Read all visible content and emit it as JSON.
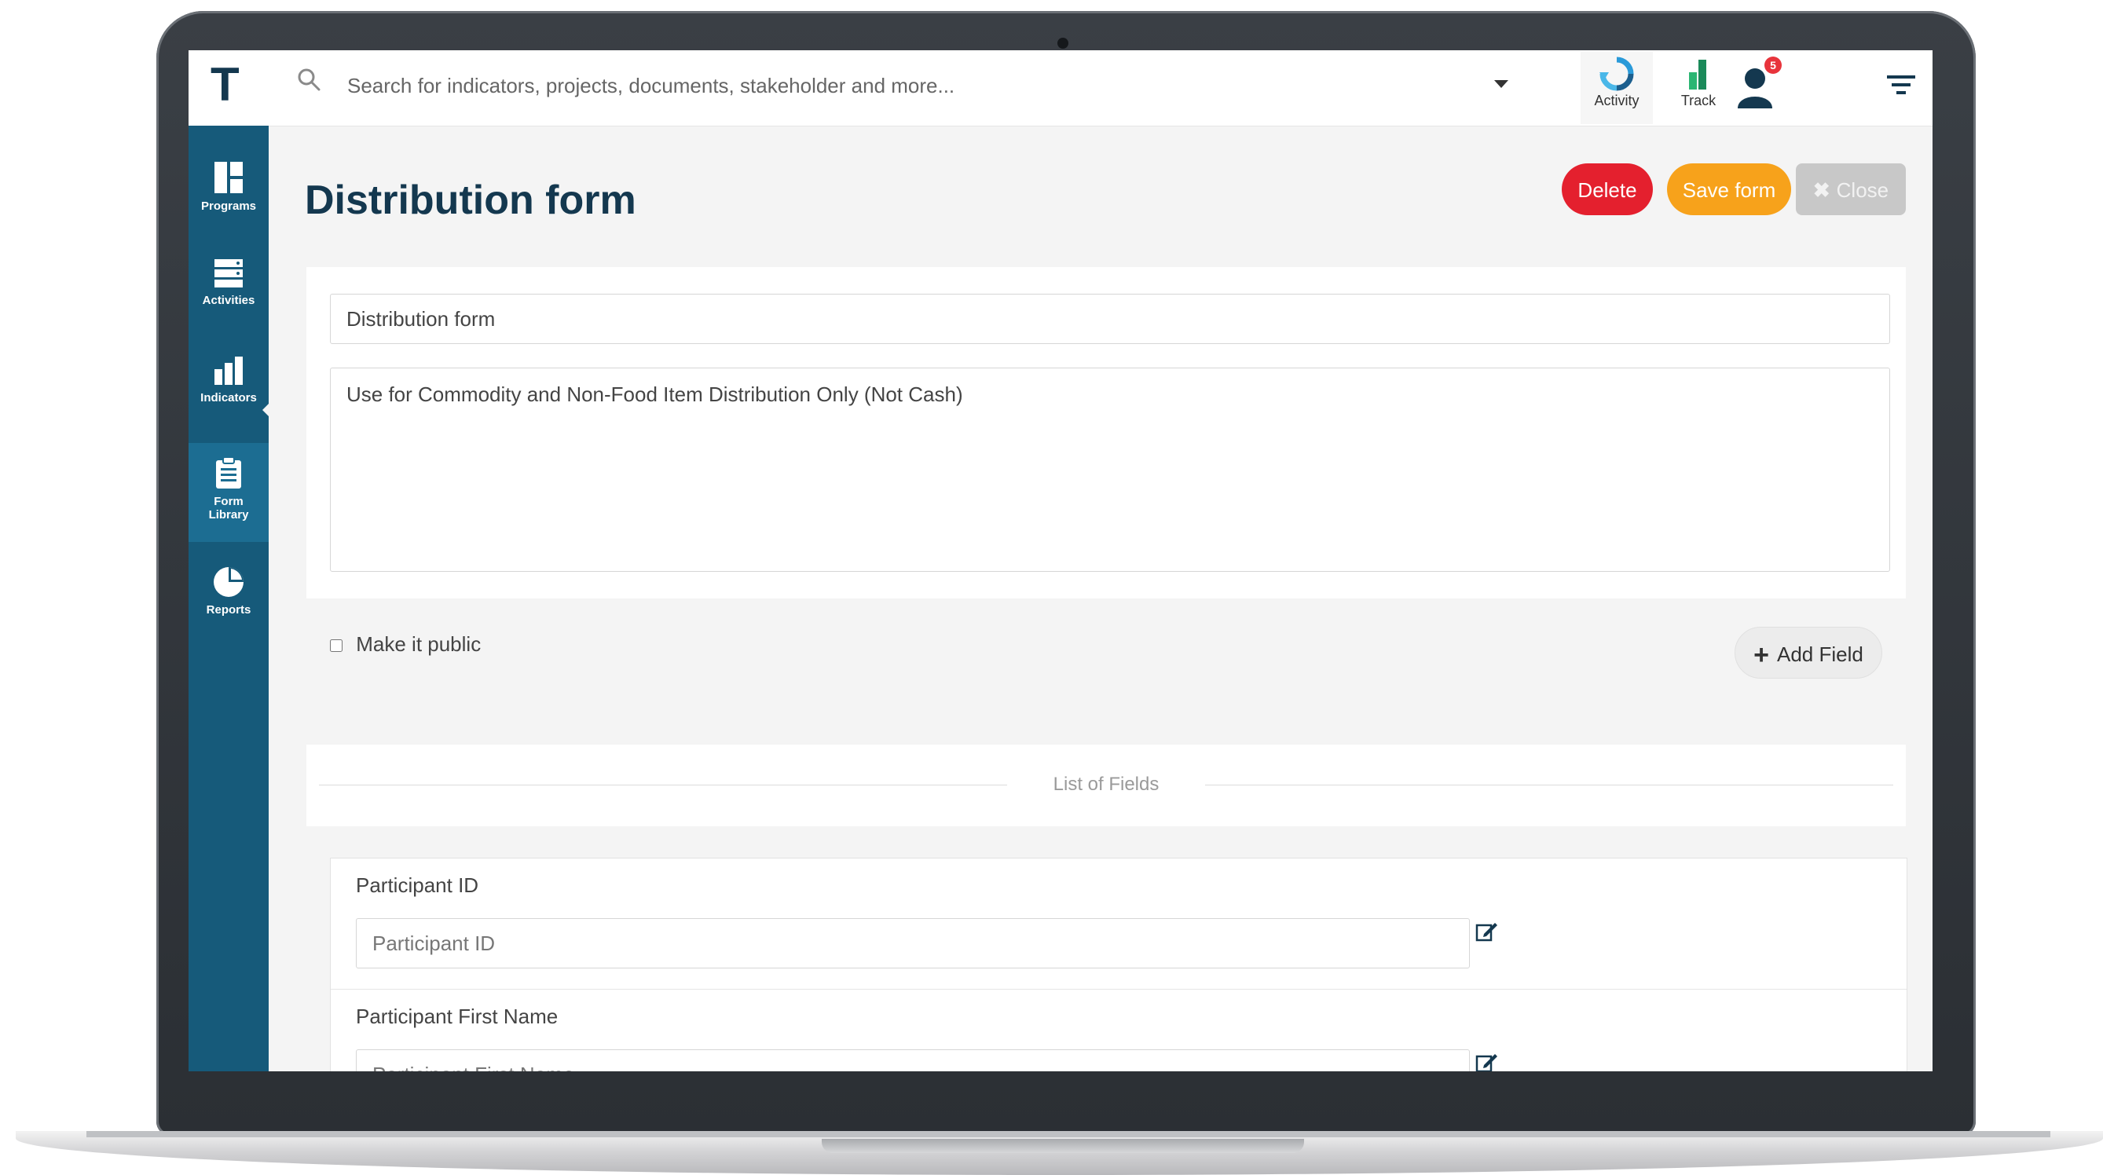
{
  "app": {
    "logo_letter": "T",
    "search_placeholder": "Search for indicators, projects, documents, stakeholder and more...",
    "tools": {
      "activity_label": "Activity",
      "track_label": "Track"
    },
    "notifications_count": "5"
  },
  "sidebar": {
    "items": [
      {
        "label": "Programs",
        "icon": "programs-icon"
      },
      {
        "label": "Activities",
        "icon": "activities-icon"
      },
      {
        "label": "Indicators",
        "icon": "indicators-icon"
      },
      {
        "label_line1": "Form",
        "label_line2": "Library",
        "icon": "clipboard-icon",
        "active": true
      },
      {
        "label": "Reports",
        "icon": "pie-chart-icon"
      }
    ]
  },
  "page": {
    "title": "Distribution form",
    "buttons": {
      "delete": "Delete",
      "save": "Save form",
      "close": "Close"
    }
  },
  "form": {
    "name_value": "Distribution form",
    "description_value": "Use for Commodity and Non-Food Item Distribution Only (Not Cash)",
    "make_public_label": "Make it public",
    "make_public_checked": false,
    "add_field_label": "Add Field"
  },
  "fields_section": {
    "title": "List of Fields",
    "fields": [
      {
        "label": "Participant ID",
        "placeholder": "Participant ID"
      },
      {
        "label": "Participant First Name",
        "placeholder": "Participant First Name"
      }
    ]
  },
  "colors": {
    "sidebar": "#165a7a",
    "title": "#14384f",
    "delete": "#e4202e",
    "save": "#f7a21b",
    "close": "#c8c8c8"
  }
}
